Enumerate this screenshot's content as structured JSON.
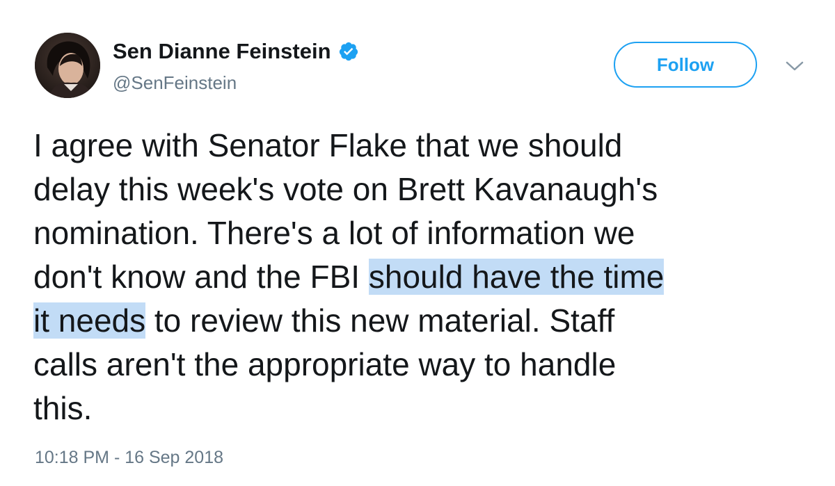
{
  "author": {
    "display_name": "Sen Dianne Feinstein",
    "handle": "@SenFeinstein",
    "verified_icon": "verified-badge-icon",
    "avatar_icon": "profile-photo"
  },
  "follow_button": {
    "label": "Follow"
  },
  "menu_icon": "chevron-down-icon",
  "tweet": {
    "lines": [
      {
        "segments": [
          {
            "text": "I agree with Senator Flake that we should",
            "highlight": false
          }
        ]
      },
      {
        "segments": [
          {
            "text": "delay this week's vote on Brett Kavanaugh's",
            "highlight": false
          }
        ]
      },
      {
        "segments": [
          {
            "text": "nomination. There's a lot of information we",
            "highlight": false
          }
        ]
      },
      {
        "segments": [
          {
            "text": "don't know and the FBI ",
            "highlight": false
          },
          {
            "text": "should have the time ",
            "highlight": true
          }
        ]
      },
      {
        "segments": [
          {
            "text": "it needs",
            "highlight": true
          },
          {
            "text": " to review this new material. Staff",
            "highlight": false
          }
        ]
      },
      {
        "segments": [
          {
            "text": "calls aren't the appropriate way to handle",
            "highlight": false
          }
        ]
      },
      {
        "segments": [
          {
            "text": "this.",
            "highlight": false
          }
        ]
      }
    ]
  },
  "timestamp": "10:18 PM - 16 Sep 2018",
  "colors": {
    "accent": "#1da1f2",
    "text": "#14171a",
    "secondary_text": "#657786",
    "highlight": "#c2dcf6"
  }
}
